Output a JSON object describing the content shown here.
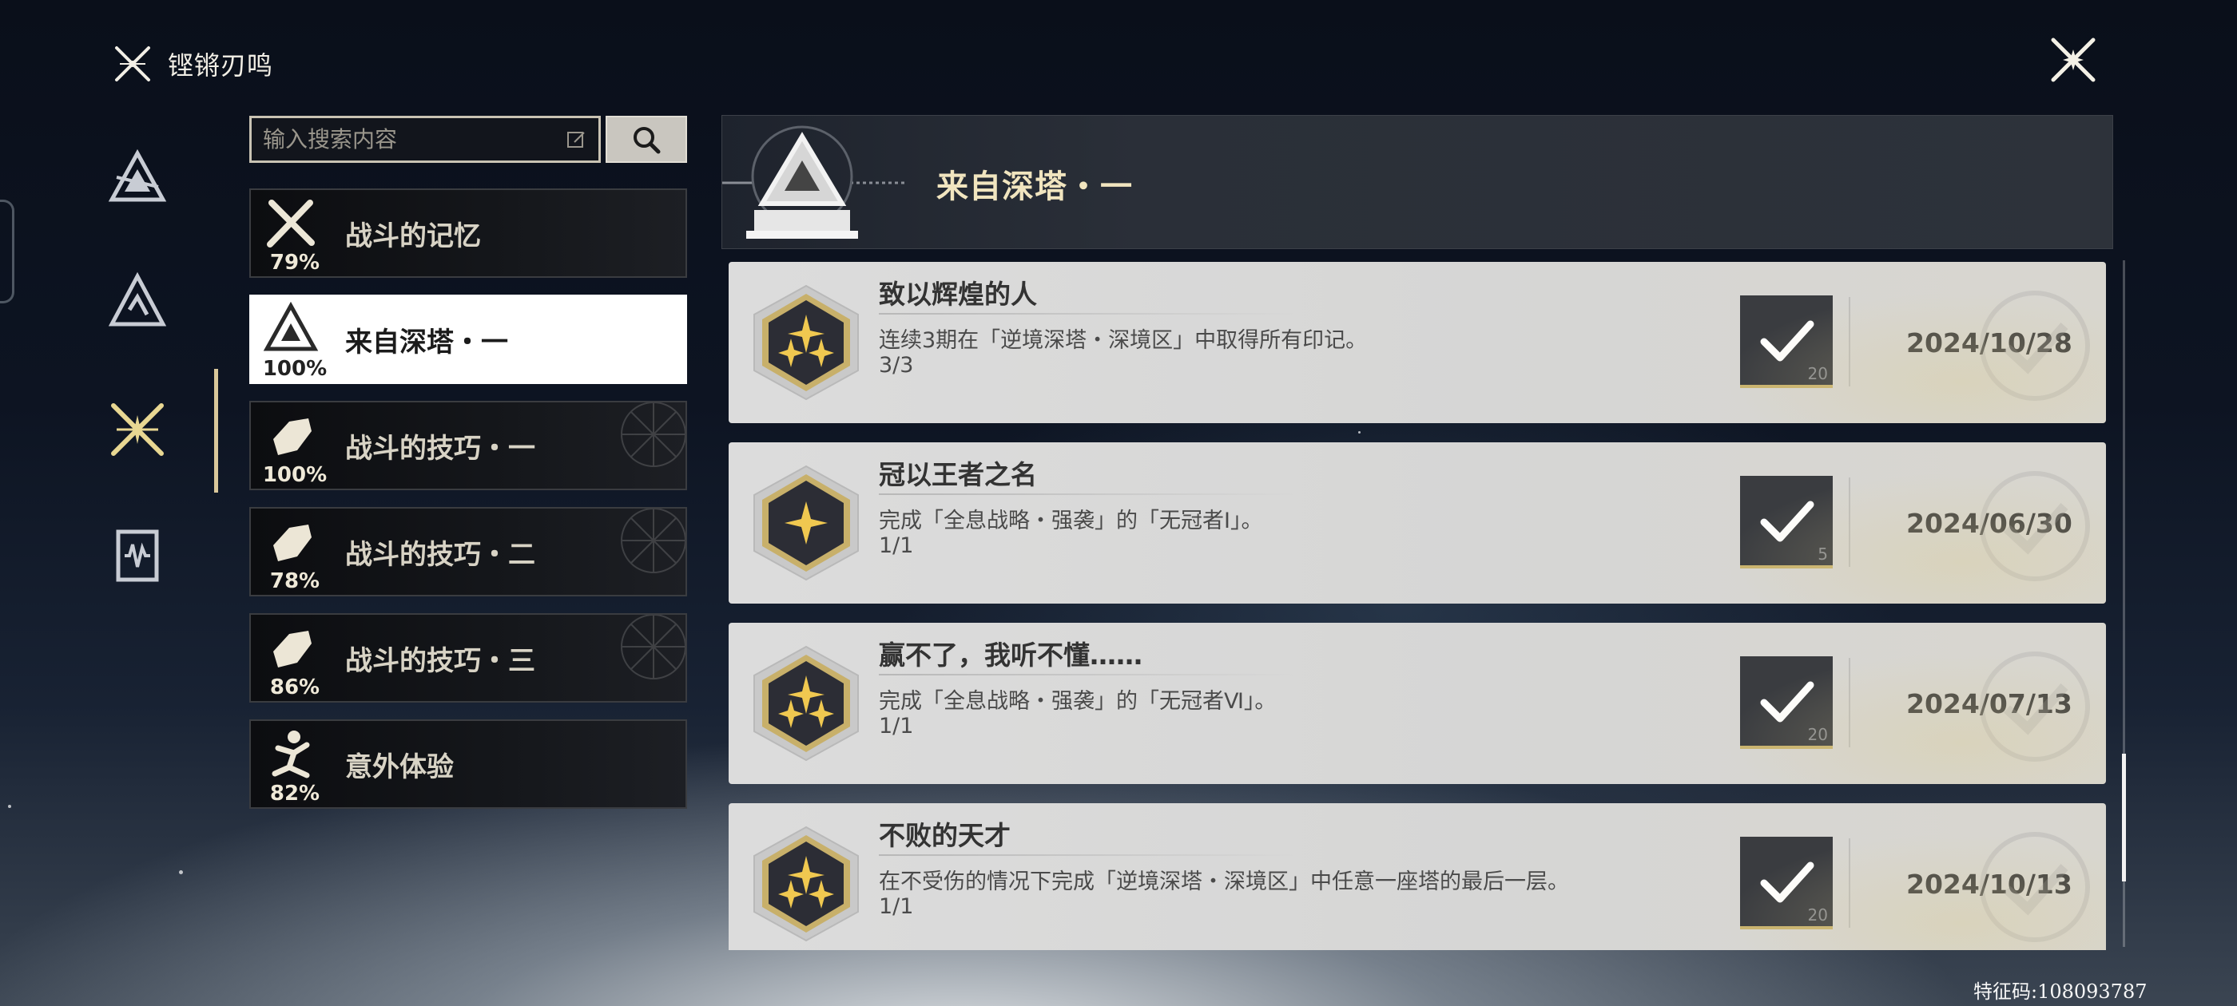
{
  "app": {
    "title": "铿锵刃鸣"
  },
  "search": {
    "placeholder": "输入搜索内容"
  },
  "nav": [
    {
      "name": "category-nav-1",
      "icon": "triangle-emblem-icon"
    },
    {
      "name": "category-nav-2",
      "icon": "mountain-icon"
    },
    {
      "name": "category-nav-3",
      "icon": "crossed-blades-icon",
      "active": true
    },
    {
      "name": "category-nav-4",
      "icon": "soundwave-card-icon"
    }
  ],
  "categories": [
    {
      "label": "战斗的记忆",
      "percent": "79%",
      "icon": "crossed-swords-icon"
    },
    {
      "label": "来自深塔・一",
      "percent": "100%",
      "icon": "tower-triangle-icon",
      "active": true
    },
    {
      "label": "战斗的技巧・一",
      "percent": "100%",
      "icon": "fist-icon"
    },
    {
      "label": "战斗的技巧・二",
      "percent": "78%",
      "icon": "fist-icon"
    },
    {
      "label": "战斗的技巧・三",
      "percent": "86%",
      "icon": "fist-icon"
    },
    {
      "label": "意外体验",
      "percent": "82%",
      "icon": "falling-person-icon"
    }
  ],
  "detail": {
    "title": "来自深塔・一",
    "achievements": [
      {
        "name": "致以辉煌的人",
        "desc": "连续3期在「逆境深塔・深境区」中取得所有印记。",
        "progress": "3/3",
        "reward": "20",
        "date": "2024/10/28",
        "stars": 3
      },
      {
        "name": "冠以王者之名",
        "desc": "完成「全息战略・强袭」的「无冠者Ⅰ」。",
        "progress": "1/1",
        "reward": "5",
        "date": "2024/06/30",
        "stars": 1
      },
      {
        "name": "赢不了，我听不懂……",
        "desc": "完成「全息战略・强袭」的「无冠者Ⅵ」。",
        "progress": "1/1",
        "reward": "20",
        "date": "2024/07/13",
        "stars": 3
      },
      {
        "name": "不败的天才",
        "desc": "在不受伤的情况下完成「逆境深塔・深境区」中任意一座塔的最后一层。",
        "progress": "1/1",
        "reward": "20",
        "date": "2024/10/13",
        "stars": 3
      }
    ]
  },
  "footer": {
    "code": "特征码:108093787"
  },
  "colors": {
    "accent_gold": "#d9c79a",
    "title_gold": "#f1e5bf",
    "card_bg": "#d8d8d7"
  }
}
